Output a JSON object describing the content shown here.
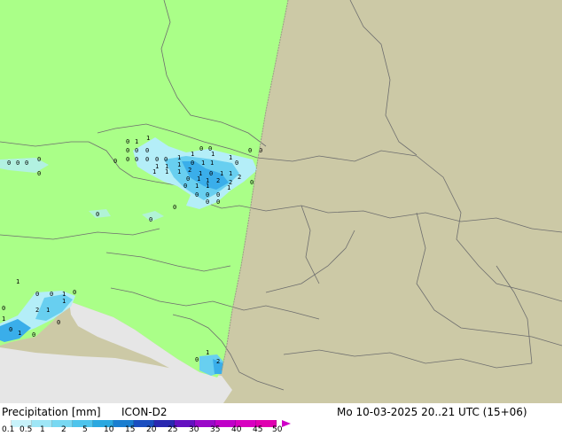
{
  "title_left": "Precipitation [mm]",
  "model": "ICON-D2",
  "timestamp": "Mo 10-03-2025 20..21 UTC (15+06)",
  "legend": {
    "ticks": [
      "0.1",
      "0.5",
      "1",
      "2",
      "5",
      "10",
      "15",
      "20",
      "25",
      "30",
      "35",
      "40",
      "45",
      "50"
    ],
    "colors": [
      "#ffffff",
      "#c8f2fa",
      "#9ee6f6",
      "#78d8f2",
      "#4ec4ec",
      "#2aa8e0",
      "#1a7ed0",
      "#1a4ec0",
      "#2a28b0",
      "#6410c0",
      "#9a08c8",
      "#c000c8",
      "#d800c0",
      "#e000b0"
    ]
  },
  "map": {
    "colors": {
      "domain_land": "#aaff88",
      "outside_domain": "#ccc9a6",
      "sea": "#e6e6e6",
      "borders": "#6e6e6e",
      "precip_light": "#b4eef8",
      "precip_medium": "#68cff0",
      "precip_strong": "#3aaeea"
    },
    "value_labels": [
      "0",
      "1",
      "1",
      "0",
      "0",
      "0",
      "0",
      "0",
      "0",
      "0",
      "0",
      "0",
      "1",
      "1",
      "1",
      "0",
      "0",
      "1",
      "1",
      "1",
      "0",
      "1",
      "1",
      "1",
      "0",
      "1",
      "1",
      "1",
      "2",
      "1",
      "0",
      "1",
      "1",
      "2",
      "2",
      "0",
      "0",
      "1",
      "1",
      "2",
      "1",
      "0",
      "1",
      "1",
      "0",
      "0",
      "0",
      "0",
      "0",
      "0",
      "0",
      "0",
      "0",
      "0",
      "0",
      "0",
      "0",
      "0",
      "0",
      "1",
      "0",
      "0",
      "1",
      "0",
      "1",
      "2",
      "1",
      "0",
      "0",
      "1",
      "0",
      "1",
      "0",
      "1",
      "0",
      "2"
    ]
  }
}
